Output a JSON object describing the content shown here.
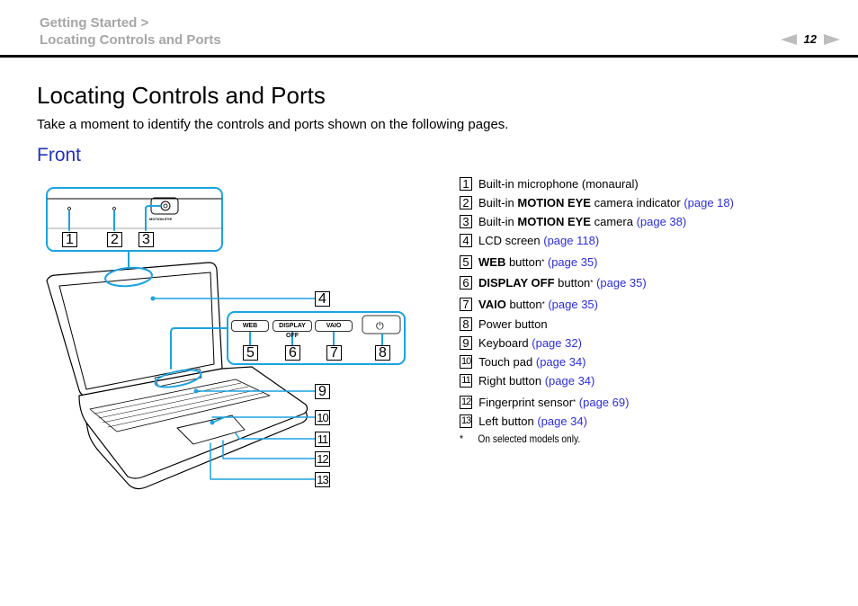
{
  "header": {
    "breadcrumb_parent": "Getting Started >",
    "breadcrumb_current": "Locating Controls and Ports",
    "page_number": "12",
    "prev_icon": "triangle-left",
    "next_icon": "triangle-right"
  },
  "main": {
    "title": "Locating Controls and Ports",
    "intro": "Take a moment to identify the controls and ports shown on the following pages.",
    "section_title": "Front"
  },
  "diagram": {
    "callouts": [
      "1",
      "2",
      "3",
      "4",
      "5",
      "6",
      "7",
      "8",
      "9",
      "10",
      "11",
      "12",
      "13"
    ],
    "button_labels": {
      "web": "WEB",
      "display_off": "DISPLAY OFF",
      "vaio": "VAIO",
      "power": "⏻"
    },
    "camera_label": "MOTION EYE",
    "accent_color": "#1aa3e0"
  },
  "legend": {
    "items": [
      {
        "num": "1",
        "pre": "Built-in microphone (monaural)",
        "bold": "",
        "post": "",
        "sup": "",
        "link": ""
      },
      {
        "num": "2",
        "pre": "Built-in ",
        "bold": "MOTION EYE",
        "post": " camera indicator ",
        "sup": "",
        "link": "(page 18)"
      },
      {
        "num": "3",
        "pre": "Built-in ",
        "bold": "MOTION EYE",
        "post": " camera ",
        "sup": "",
        "link": "(page 38)"
      },
      {
        "num": "4",
        "pre": "LCD screen ",
        "bold": "",
        "post": "",
        "sup": "",
        "link": "(page 118)"
      },
      {
        "num": "5",
        "pre": "",
        "bold": "WEB",
        "post": " button",
        "sup": "*",
        "link": "(page 35)"
      },
      {
        "num": "6",
        "pre": "",
        "bold": "DISPLAY OFF",
        "post": " button",
        "sup": "*",
        "link": "(page 35)"
      },
      {
        "num": "7",
        "pre": "",
        "bold": "VAIO",
        "post": " button",
        "sup": "*",
        "link": "(page 35)"
      },
      {
        "num": "8",
        "pre": "Power button",
        "bold": "",
        "post": "",
        "sup": "",
        "link": ""
      },
      {
        "num": "9",
        "pre": "Keyboard ",
        "bold": "",
        "post": "",
        "sup": "",
        "link": "(page 32)"
      },
      {
        "num": "10",
        "pre": "Touch pad ",
        "bold": "",
        "post": "",
        "sup": "",
        "link": "(page 34)"
      },
      {
        "num": "11",
        "pre": "Right button ",
        "bold": "",
        "post": "",
        "sup": "",
        "link": "(page 34)"
      },
      {
        "num": "12",
        "pre": "Fingerprint sensor",
        "bold": "",
        "post": "",
        "sup": "*",
        "link": "(page 69)"
      },
      {
        "num": "13",
        "pre": "Left button ",
        "bold": "",
        "post": "",
        "sup": "",
        "link": "(page 34)"
      }
    ],
    "footnote_mark": "*",
    "footnote": "On selected models only."
  }
}
